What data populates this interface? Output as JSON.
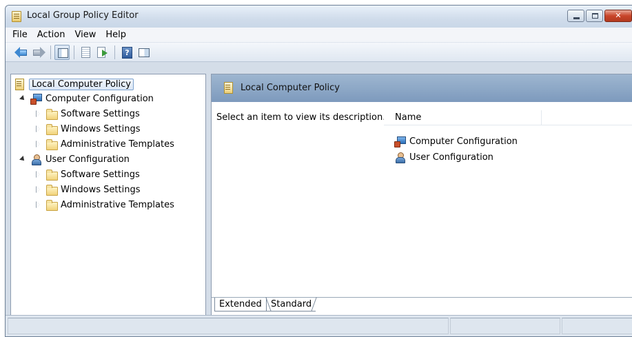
{
  "window": {
    "title": "Local Group Policy Editor"
  },
  "menu": [
    "File",
    "Action",
    "View",
    "Help"
  ],
  "toolbar": {
    "buttons": [
      "back-arrow-icon",
      "forward-arrow-icon",
      "show-hide-tree-icon",
      "properties-icon",
      "export-list-icon",
      "help-icon",
      "show-hide-action-pane-icon"
    ]
  },
  "tree": {
    "root": "Local Computer Policy",
    "computer": {
      "label": "Computer Configuration",
      "children": [
        "Software Settings",
        "Windows Settings",
        "Administrative Templates"
      ]
    },
    "user": {
      "label": "User Configuration",
      "children": [
        "Software Settings",
        "Windows Settings",
        "Administrative Templates"
      ]
    }
  },
  "right_pane": {
    "header": "Local Computer Policy",
    "description": "Select an item to view its description.",
    "column_name": "Name",
    "items": [
      "Computer Configuration",
      "User Configuration"
    ]
  },
  "tabs": [
    "Extended",
    "Standard"
  ],
  "colors": {
    "header_band": "#8aa5c6",
    "window_frame": "#d4dde8",
    "accent_blue": "#2d5a9c"
  }
}
